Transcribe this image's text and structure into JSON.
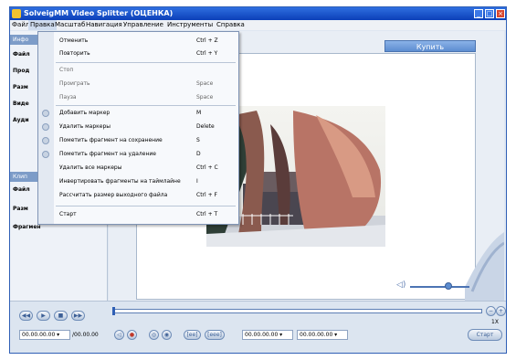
{
  "window": {
    "title": "SolveigMM Video Splitter  (ОЦЕНКА)",
    "controls": {
      "minimize": "_",
      "maximize": "□",
      "close": "×"
    }
  },
  "menubar": {
    "items": [
      "Файл",
      "Правка",
      "Масштаб",
      "Навигация",
      "Управление",
      "Инструменты",
      "Справка"
    ]
  },
  "left_panel": {
    "header1": "Инфо",
    "labels1": [
      "Файл",
      "Прод",
      "Разм",
      "Виде",
      "Ауди"
    ],
    "header2": "Клип",
    "labels2": [
      "Файл",
      "Разм",
      "Фрагмен"
    ]
  },
  "main": {
    "buy_label": "Купить"
  },
  "edit_menu": {
    "items": [
      {
        "label": "Отменить",
        "shortcut": "Ctrl + Z"
      },
      {
        "label": "Повторить",
        "shortcut": "Ctrl + Y"
      },
      {
        "label": "Стоп",
        "shortcut": ""
      },
      {
        "label": "Проиграть",
        "shortcut": "Space"
      },
      {
        "label": "Пауза",
        "shortcut": "Space"
      },
      {
        "label": "Добавить маркер",
        "shortcut": "M"
      },
      {
        "label": "Удалить маркеры",
        "shortcut": "Delete"
      },
      {
        "label": "Пометить фрагмент на сохранение",
        "shortcut": "S"
      },
      {
        "label": "Пометить фрагмент на удаление",
        "shortcut": "D"
      },
      {
        "label": "Удалить все маркеры",
        "shortcut": "Ctrl + C"
      },
      {
        "label": "Инвертировать фрагменты на таймлайне",
        "shortcut": "I"
      },
      {
        "label": "Рассчитать размер выходного файла",
        "shortcut": "Ctrl + F"
      },
      {
        "label": "Старт",
        "shortcut": "Ctrl + T"
      }
    ]
  },
  "bottom": {
    "time_current": "00.00.00.00 ▾",
    "time_total": "/00.00.00",
    "mark_start": "00.00.00.00 ▾",
    "mark_end": "00.00.00.00 ▾",
    "zoom_label": "1X",
    "start_button": "Старт",
    "btn_in": "[ee]",
    "btn_out": "[eee]",
    "player_icons": [
      "rewind-icon",
      "play-icon",
      "stop-icon",
      "fast-forward-icon"
    ],
    "volume_level": 0.65
  }
}
